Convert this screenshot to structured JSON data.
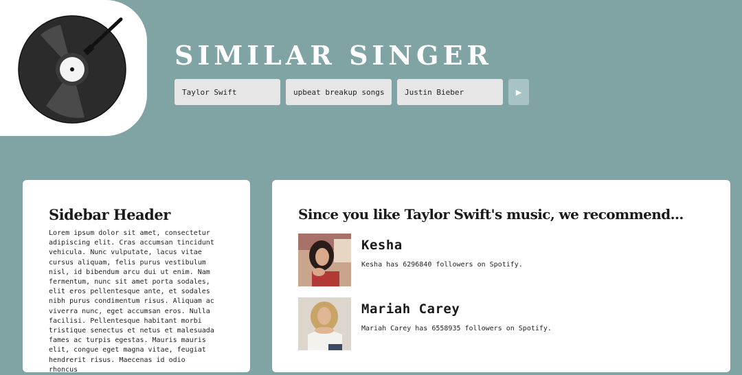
{
  "header": {
    "title": "SIMILAR SINGER",
    "inputs": {
      "artist_value": "Taylor Swift",
      "mood_value": "upbeat breakup songs",
      "artist2_value": "Justin Bieber"
    },
    "submit_label": "▶"
  },
  "sidebar": {
    "header": "Sidebar Header",
    "body": "Lorem ipsum dolor sit amet, consectetur adipiscing elit. Cras accumsan tincidunt vehicula. Nunc vulputate, lacus vitae cursus aliquam, felis purus vestibulum nisl, id bibendum arcu dui ut enim. Nam fermentum, nunc sit amet porta sodales, elit eros pellentesque ante, et sodales nibh purus condimentum risus. Aliquam ac viverra nunc, eget accumsan eros. Nulla facilisi. Pellentesque habitant morbi tristique senectus et netus et malesuada fames ac turpis egestas. Mauris mauris elit, congue eget magna vitae, feugiat hendrerit risus. Maecenas id odio rhoncus"
  },
  "main": {
    "header": "Since you like Taylor Swift's music, we recommend...",
    "recommendations": [
      {
        "name": "Kesha",
        "followers_text": "Kesha has 6296840 followers on Spotify."
      },
      {
        "name": "Mariah Carey",
        "followers_text": "Mariah Carey has 6558935 followers on Spotify."
      }
    ]
  },
  "colors": {
    "background": "#80a3a4",
    "card": "#ffffff",
    "input": "#e6e6e6",
    "button": "#a8c3c4",
    "record": "#2b2b2b"
  }
}
